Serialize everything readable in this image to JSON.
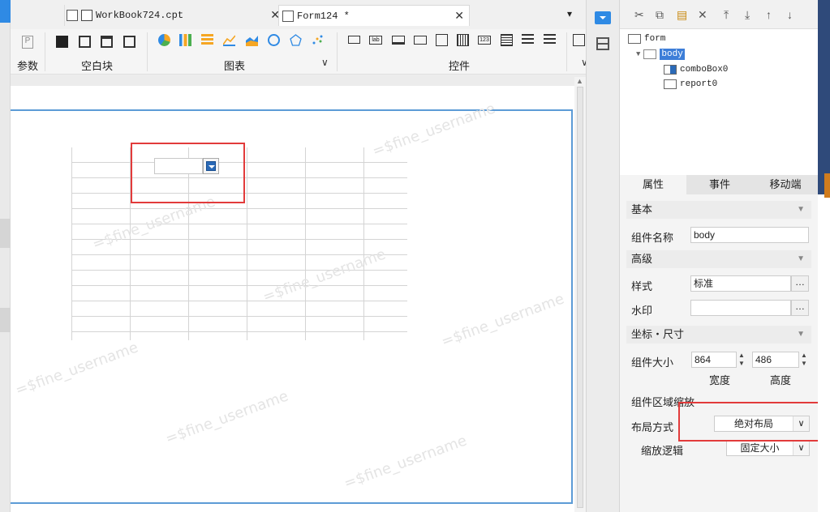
{
  "tabs": [
    {
      "label": "WorkBook724.cpt",
      "icon": "grid-icon",
      "closable": true
    },
    {
      "label": "Form124 *",
      "icon": "form-icon",
      "closable": true,
      "active": true
    }
  ],
  "toolbar": {
    "groups": [
      {
        "label": "参数"
      },
      {
        "label": "空白块"
      },
      {
        "label": "图表"
      },
      {
        "label": "控件"
      }
    ]
  },
  "canvas": {
    "watermark": "=$fine_username"
  },
  "tree": {
    "nodes": [
      {
        "label": "form"
      },
      {
        "label": "body",
        "selected": true
      },
      {
        "label": "comboBox0"
      },
      {
        "label": "report0"
      }
    ]
  },
  "right_tabs": [
    "属性",
    "事件",
    "移动端"
  ],
  "properties": {
    "basic_section": "基本",
    "component_name_label": "组件名称",
    "component_name_value": "body",
    "advanced_section": "高级",
    "style_label": "样式",
    "style_value": "标准",
    "watermark_label": "水印",
    "watermark_value": "",
    "position_section": "坐标・尺寸",
    "size_label": "组件大小",
    "width_value": "864",
    "height_value": "486",
    "width_caption": "宽度",
    "height_caption": "高度",
    "scale_section": "组件区域缩放",
    "layout_label": "布局方式",
    "layout_value": "绝对布局",
    "scale_logic_label": "缩放逻辑",
    "scale_logic_value": "固定大小",
    "more_label": "…"
  },
  "colors": {
    "accent": "#5c9bd6",
    "highlight": "#e23b3b",
    "selected_tree": "#3d7ed8"
  }
}
